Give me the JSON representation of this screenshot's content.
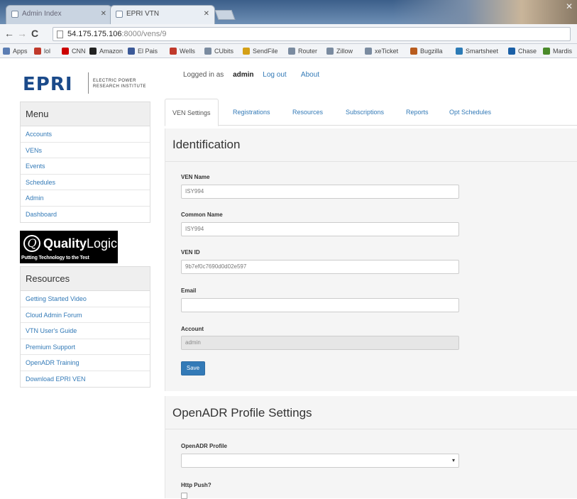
{
  "browser": {
    "tabs": [
      {
        "title": "Admin Index"
      },
      {
        "title": "EPRI VTN"
      }
    ],
    "url_host": "54.175.175.106",
    "url_path": ":8000/vens/9",
    "bookmarks": [
      {
        "label": "Apps",
        "color": "#5b7db3"
      },
      {
        "label": "lol",
        "color": "#c0392b"
      },
      {
        "label": "CNN",
        "color": "#cc0000"
      },
      {
        "label": "Amazon",
        "color": "#222222"
      },
      {
        "label": "El Pais",
        "color": "#3b5998"
      },
      {
        "label": "Wells",
        "color": "#c0392b"
      },
      {
        "label": "CUbits",
        "color": "#7a8ba0"
      },
      {
        "label": "SendFile",
        "color": "#d4a017"
      },
      {
        "label": "Router",
        "color": "#7a8ba0"
      },
      {
        "label": "Zillow",
        "color": "#7a8ba0"
      },
      {
        "label": "xeTicket",
        "color": "#7a8ba0"
      },
      {
        "label": "Bugzilla",
        "color": "#b85c1e"
      },
      {
        "label": "Smartsheet",
        "color": "#2c7bb6"
      },
      {
        "label": "Chase",
        "color": "#1a5fa6"
      },
      {
        "label": "Mardis",
        "color": "#4a8a2a"
      }
    ]
  },
  "logo": {
    "mark": "EPRI",
    "tagline_line1": "ELECTRIC POWER",
    "tagline_line2": "RESEARCH INSTITUTE"
  },
  "topnav": {
    "logged_in_prefix": "Logged in as",
    "username": "admin",
    "logout": "Log out",
    "about": "About"
  },
  "menu": {
    "title": "Menu",
    "items": [
      {
        "label": "Accounts"
      },
      {
        "label": "VENs"
      },
      {
        "label": "Events"
      },
      {
        "label": "Schedules"
      },
      {
        "label": "Admin"
      },
      {
        "label": "Dashboard"
      }
    ]
  },
  "qualitylogic": {
    "name_bold": "Quality",
    "name_light": "Logic.",
    "tagline": "Putting Technology to the Test"
  },
  "resources": {
    "title": "Resources",
    "items": [
      {
        "label": "Getting Started Video"
      },
      {
        "label": "Cloud Admin Forum"
      },
      {
        "label": "VTN User's Guide"
      },
      {
        "label": "Premium Support"
      },
      {
        "label": "OpenADR Training"
      },
      {
        "label": "Download EPRI VEN"
      }
    ]
  },
  "tabs": [
    {
      "label": "VEN Settings",
      "active": true
    },
    {
      "label": "Registrations",
      "active": false
    },
    {
      "label": "Resources",
      "active": false
    },
    {
      "label": "Subscriptions",
      "active": false
    },
    {
      "label": "Reports",
      "active": false
    },
    {
      "label": "Opt Schedules",
      "active": false
    }
  ],
  "identification": {
    "title": "Identification",
    "ven_name_label": "VEN Name",
    "ven_name_value": "ISY994",
    "common_name_label": "Common Name",
    "common_name_value": "ISY994",
    "ven_id_label": "VEN ID",
    "ven_id_value": "9b7ef0c7690d0d02e597",
    "email_label": "Email",
    "email_value": "",
    "account_label": "Account",
    "account_value": "admin",
    "save_label": "Save"
  },
  "profile": {
    "title": "OpenADR Profile Settings",
    "profile_label": "OpenADR Profile",
    "profile_value": "",
    "http_push_label": "Http Push?"
  }
}
